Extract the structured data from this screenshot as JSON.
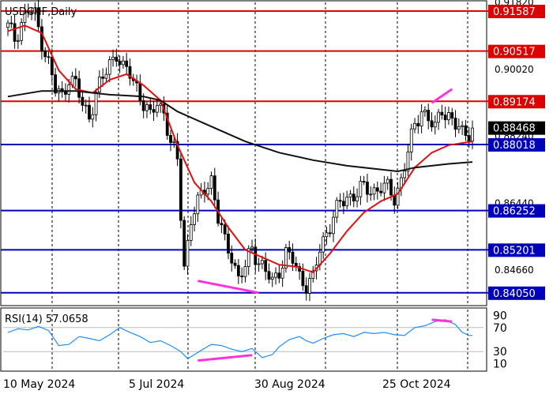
{
  "chart_data": [
    {
      "type": "candlestick",
      "title": "USDCHF,Daily",
      "ylim": [
        0.8375,
        0.9182
      ],
      "y_ticks": [
        "0.91820",
        "0.90020",
        "0.88240",
        "0.86440",
        "0.84660"
      ],
      "x_tick_labels": [
        "10 May 2024",
        "5 Jul 2024",
        "30 Aug 2024",
        "25 Oct 2024"
      ],
      "horizontal_levels": [
        {
          "value": 0.91587,
          "label": "0.91587",
          "color": "#dd0000"
        },
        {
          "value": 0.90517,
          "label": "0.90517",
          "color": "#dd0000"
        },
        {
          "value": 0.89174,
          "label": "0.89174",
          "color": "#dd0000"
        },
        {
          "value": 0.88018,
          "label": "0.88018",
          "color": "#0000bb"
        },
        {
          "value": 0.86252,
          "label": "0.86252",
          "color": "#0000bb"
        },
        {
          "value": 0.85201,
          "label": "0.85201",
          "color": "#0000bb"
        },
        {
          "value": 0.8405,
          "label": "0.84050",
          "color": "#0000bb"
        }
      ],
      "current_price": {
        "value": 0.88468,
        "label": "0.88468"
      },
      "price_path": [
        [
          0,
          0.9115
        ],
        [
          2,
          0.9085
        ],
        [
          4,
          0.913
        ],
        [
          6,
          0.916
        ],
        [
          8,
          0.9145
        ],
        [
          10,
          0.908
        ],
        [
          12,
          0.902
        ],
        [
          14,
          0.8945
        ],
        [
          16,
          0.893
        ],
        [
          18,
          0.8985
        ],
        [
          20,
          0.896
        ],
        [
          22,
          0.8905
        ],
        [
          24,
          0.888
        ],
        [
          26,
          0.894
        ],
        [
          28,
          0.8975
        ],
        [
          30,
          0.902
        ],
        [
          32,
          0.905
        ],
        [
          34,
          0.9
        ],
        [
          36,
          0.899
        ],
        [
          38,
          0.896
        ],
        [
          40,
          0.891
        ],
        [
          42,
          0.887
        ],
        [
          44,
          0.892
        ],
        [
          46,
          0.889
        ],
        [
          48,
          0.88
        ],
        [
          50,
          0.876
        ],
        [
          51,
          0.862
        ],
        [
          52,
          0.848
        ],
        [
          54,
          0.86
        ],
        [
          56,
          0.864
        ],
        [
          58,
          0.869
        ],
        [
          60,
          0.871
        ],
        [
          62,
          0.86
        ],
        [
          64,
          0.854
        ],
        [
          66,
          0.851
        ],
        [
          68,
          0.844
        ],
        [
          70,
          0.847
        ],
        [
          72,
          0.853
        ],
        [
          74,
          0.849
        ],
        [
          76,
          0.846
        ],
        [
          78,
          0.843
        ],
        [
          80,
          0.847
        ],
        [
          82,
          0.851
        ],
        [
          84,
          0.849
        ],
        [
          86,
          0.845
        ],
        [
          88,
          0.843
        ],
        [
          90,
          0.844
        ],
        [
          92,
          0.852
        ],
        [
          94,
          0.857
        ],
        [
          96,
          0.861
        ],
        [
          98,
          0.864
        ],
        [
          100,
          0.866
        ],
        [
          102,
          0.867
        ],
        [
          104,
          0.868
        ],
        [
          106,
          0.868
        ],
        [
          108,
          0.868
        ],
        [
          110,
          0.869
        ],
        [
          112,
          0.868
        ],
        [
          114,
          0.866
        ],
        [
          116,
          0.871
        ],
        [
          118,
          0.878
        ],
        [
          120,
          0.885
        ],
        [
          122,
          0.89
        ],
        [
          124,
          0.887
        ],
        [
          126,
          0.884
        ],
        [
          128,
          0.89
        ],
        [
          130,
          0.888
        ],
        [
          132,
          0.885
        ],
        [
          134,
          0.883
        ],
        [
          136,
          0.884
        ],
        [
          137,
          0.8847
        ]
      ],
      "moving_averages": [
        {
          "color": "#dd1111",
          "points": [
            [
              0,
              0.9105
            ],
            [
              5,
              0.912
            ],
            [
              10,
              0.91
            ],
            [
              15,
              0.9
            ],
            [
              20,
              0.895
            ],
            [
              25,
              0.894
            ],
            [
              30,
              0.8975
            ],
            [
              35,
              0.899
            ],
            [
              40,
              0.896
            ],
            [
              45,
              0.892
            ],
            [
              50,
              0.88
            ],
            [
              55,
              0.87
            ],
            [
              60,
              0.865
            ],
            [
              65,
              0.858
            ],
            [
              70,
              0.852
            ],
            [
              75,
              0.85
            ],
            [
              80,
              0.848
            ],
            [
              85,
              0.8475
            ],
            [
              90,
              0.846
            ],
            [
              95,
              0.851
            ],
            [
              100,
              0.857
            ],
            [
              105,
              0.862
            ],
            [
              110,
              0.865
            ],
            [
              115,
              0.867
            ],
            [
              120,
              0.874
            ],
            [
              125,
              0.878
            ],
            [
              130,
              0.88
            ],
            [
              137,
              0.881
            ]
          ]
        },
        {
          "color": "#111111",
          "points": [
            [
              0,
              0.893
            ],
            [
              10,
              0.8945
            ],
            [
              20,
              0.8945
            ],
            [
              30,
              0.8935
            ],
            [
              40,
              0.893
            ],
            [
              45,
              0.892
            ],
            [
              50,
              0.889
            ],
            [
              60,
              0.885
            ],
            [
              70,
              0.881
            ],
            [
              80,
              0.878
            ],
            [
              90,
              0.876
            ],
            [
              100,
              0.8745
            ],
            [
              110,
              0.8735
            ],
            [
              115,
              0.873
            ],
            [
              120,
              0.874
            ],
            [
              130,
              0.875
            ],
            [
              137,
              0.8755
            ]
          ]
        }
      ],
      "divergence_lines": [
        {
          "color": "#ff33dd",
          "points": [
            [
              125,
              0.8913
            ],
            [
              131,
              0.895
            ]
          ]
        },
        {
          "color": "#ff33dd",
          "points": [
            [
              56,
              0.8437
            ],
            [
              74,
              0.8405
            ]
          ]
        }
      ]
    },
    {
      "type": "line",
      "title": "RSI(14) 57.0658",
      "ylim": [
        0,
        100
      ],
      "y_ticks": [
        "90",
        "70",
        "30",
        "10"
      ],
      "reference_levels": [
        70,
        30
      ],
      "values": [
        [
          0,
          62
        ],
        [
          3,
          68
        ],
        [
          6,
          66
        ],
        [
          9,
          72
        ],
        [
          12,
          65
        ],
        [
          15,
          40
        ],
        [
          18,
          42
        ],
        [
          21,
          55
        ],
        [
          24,
          52
        ],
        [
          27,
          48
        ],
        [
          30,
          58
        ],
        [
          33,
          70
        ],
        [
          36,
          62
        ],
        [
          39,
          55
        ],
        [
          42,
          45
        ],
        [
          45,
          48
        ],
        [
          48,
          40
        ],
        [
          51,
          30
        ],
        [
          53,
          18
        ],
        [
          55,
          25
        ],
        [
          57,
          32
        ],
        [
          60,
          42
        ],
        [
          63,
          40
        ],
        [
          66,
          34
        ],
        [
          69,
          30
        ],
        [
          72,
          35
        ],
        [
          75,
          20
        ],
        [
          78,
          25
        ],
        [
          80,
          38
        ],
        [
          83,
          50
        ],
        [
          86,
          55
        ],
        [
          88,
          48
        ],
        [
          90,
          44
        ],
        [
          93,
          52
        ],
        [
          96,
          58
        ],
        [
          99,
          60
        ],
        [
          102,
          55
        ],
        [
          105,
          62
        ],
        [
          108,
          60
        ],
        [
          111,
          62
        ],
        [
          114,
          58
        ],
        [
          117,
          57
        ],
        [
          120,
          70
        ],
        [
          123,
          73
        ],
        [
          126,
          80
        ],
        [
          129,
          83
        ],
        [
          132,
          75
        ],
        [
          134,
          62
        ],
        [
          136,
          57
        ],
        [
          137,
          57
        ]
      ],
      "divergence_lines": [
        {
          "color": "#ff33dd",
          "points": [
            [
              125,
              83
            ],
            [
              131,
              80
            ]
          ]
        },
        {
          "color": "#ff33dd",
          "points": [
            [
              56,
              15
            ],
            [
              72,
              24
            ]
          ]
        }
      ]
    }
  ]
}
